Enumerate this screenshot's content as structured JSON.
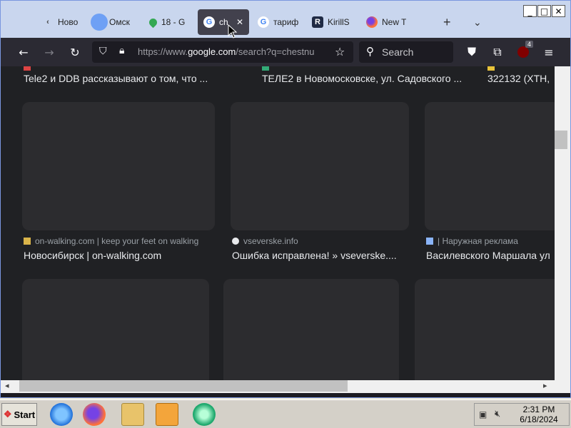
{
  "browser": {
    "tabs": [
      {
        "label": "Ново",
        "icon": "chevron-left-icon"
      },
      {
        "label": "Омск",
        "icon": "blue-circle-icon"
      },
      {
        "label": "18 - G",
        "icon": "maps-pin-icon"
      },
      {
        "label": "ch",
        "icon": "google-icon",
        "active": true
      },
      {
        "label": "тариф",
        "icon": "google-icon"
      },
      {
        "label": "KirillS",
        "icon": "r-logo-icon"
      },
      {
        "label": "New T",
        "icon": "firefox-icon"
      }
    ],
    "url": {
      "prefix": "https://www.",
      "domain": "google.com",
      "path": "/search?q=chestnu"
    },
    "search_placeholder": "Search",
    "extension_badge": "4"
  },
  "results": {
    "top_row": [
      {
        "title": "Tele2 и DDB рассказывают о том, что ..."
      },
      {
        "title": "ТЕЛЕ2 в Новомосковске, ул. Садовского ..."
      },
      {
        "title": "322132 (XTH,"
      }
    ],
    "middle_row": [
      {
        "source": "on-walking.com | keep your feet on walking",
        "title": "Новосибирск | on-walking.com"
      },
      {
        "source": "vseverske.info",
        "title": "Ошибка исправлена! » vseverske...."
      },
      {
        "source": "| Наружная реклама",
        "title": "Василевского Маршала ул"
      }
    ]
  },
  "taskbar": {
    "start_label": "Start",
    "time": "2:31 PM",
    "date": "6/18/2024"
  }
}
